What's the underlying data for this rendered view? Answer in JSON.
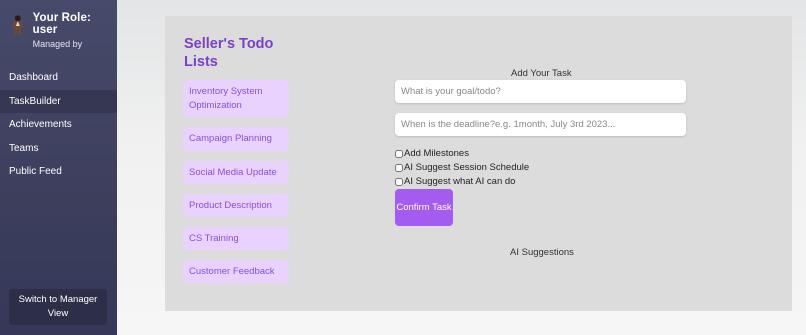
{
  "sidebar": {
    "role_title": "Your Role: user",
    "role_subtitle": "Managed by",
    "avatar_icon": "user-avatar-icon",
    "nav": [
      {
        "label": "Dashboard",
        "active": false
      },
      {
        "label": "TaskBuilder",
        "active": true
      },
      {
        "label": "Achievements",
        "active": false
      },
      {
        "label": "Teams",
        "active": false
      },
      {
        "label": "Public Feed",
        "active": false
      }
    ],
    "switch_label": "Switch to Manager View"
  },
  "main": {
    "title": "Seller's Todo Lists",
    "todo_lists": [
      "Inventory System Optimization",
      "Campaign Planning",
      "Social Media Update",
      "Product Description",
      "CS Training",
      "Customer Feedback"
    ],
    "add_task": {
      "title": "Add Your Task",
      "goal_placeholder": "What is your goal/todo?",
      "deadline_placeholder": "When is the deadline?e.g. 1month, July 3rd 2023...",
      "options": [
        "Add Milestones",
        "AI Suggest Session Schedule",
        "AI Suggest what AI can do"
      ],
      "confirm_label": "Confirm Task"
    },
    "ai_suggestions_title": "AI Suggestions"
  },
  "colors": {
    "sidebar_bg": "#3c3e5c",
    "accent_purple": "#a35bf0",
    "list_item_bg": "#ead2ff",
    "title_purple": "#7b3fc9"
  }
}
